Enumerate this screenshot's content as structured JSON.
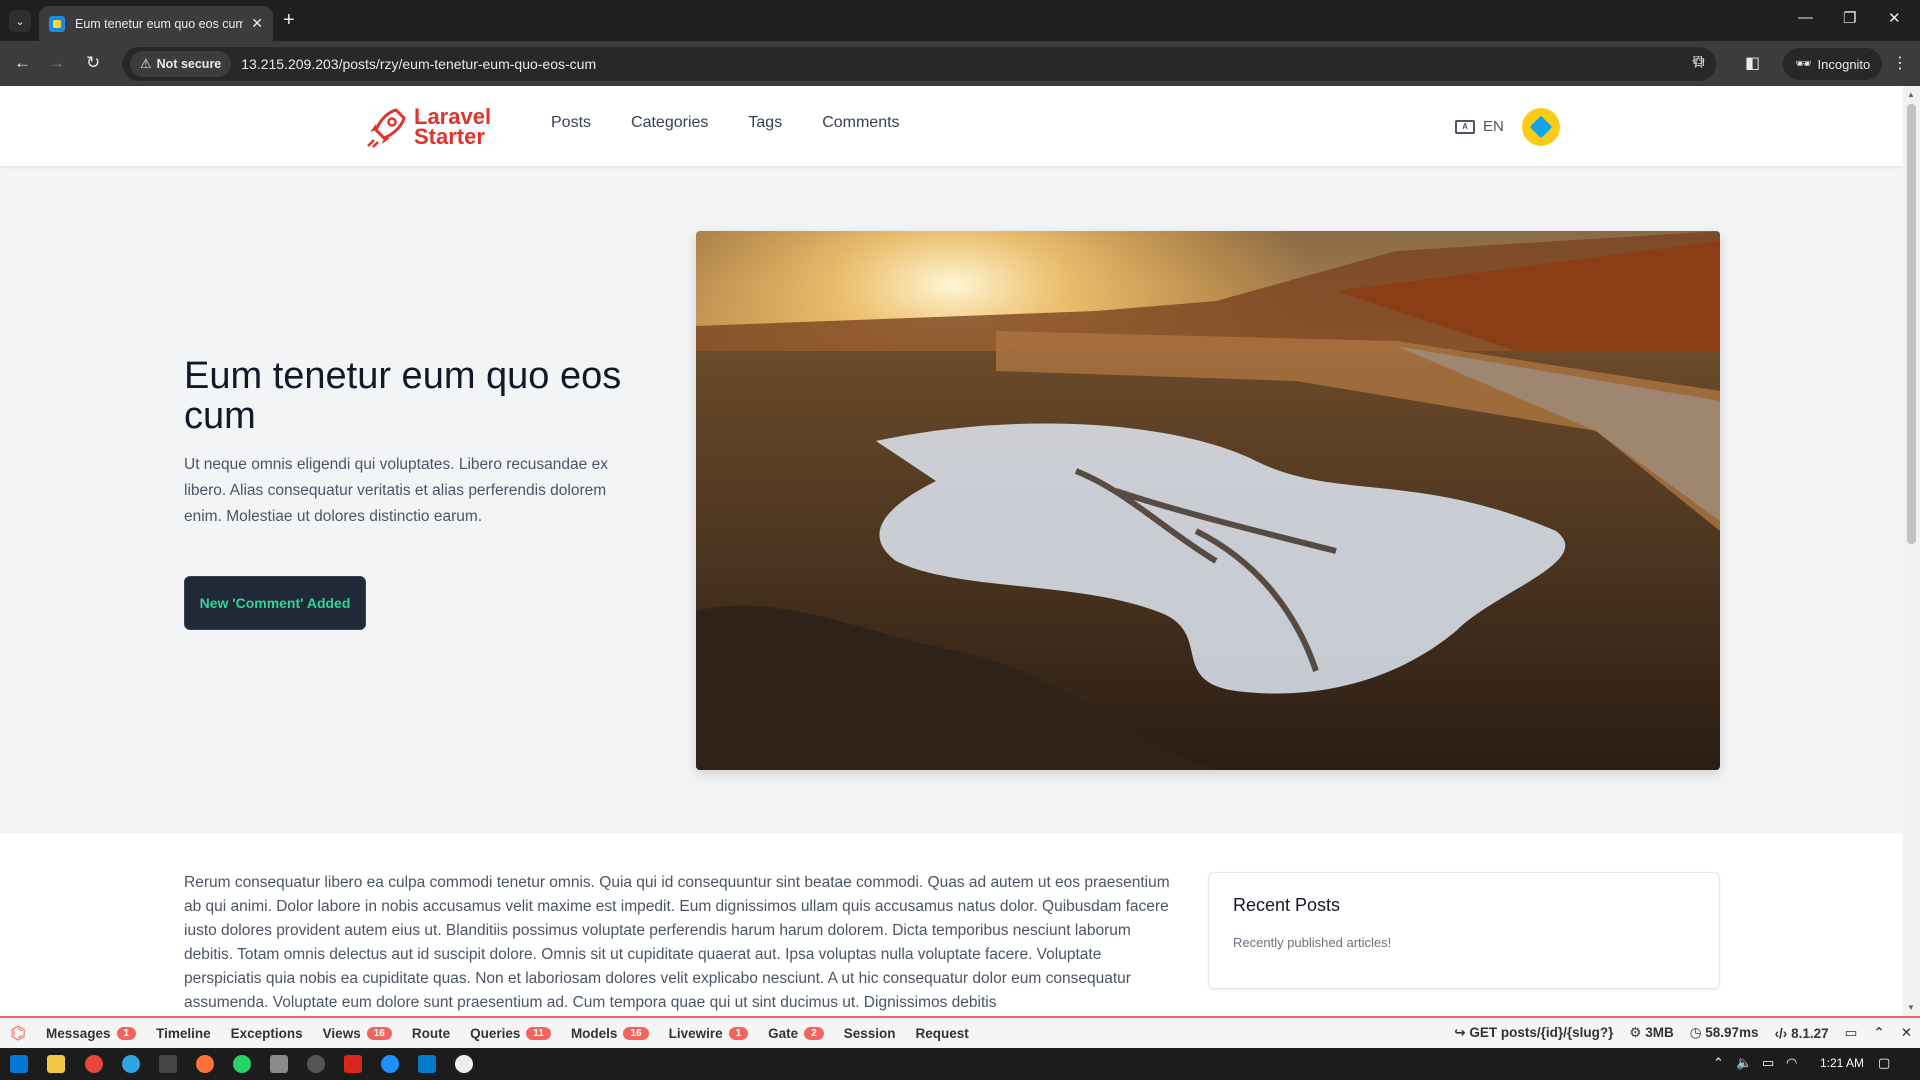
{
  "browser": {
    "tab_title": "Eum tenetur eum quo eos cum",
    "not_secure_label": "Not secure",
    "url": "13.215.209.203/posts/rzy/eum-tenetur-eum-quo-eos-cum",
    "incognito_label": "Incognito"
  },
  "site": {
    "logo_line1": "Laravel",
    "logo_line2": "Starter",
    "nav": [
      "Posts",
      "Categories",
      "Tags",
      "Comments"
    ],
    "lang": "EN"
  },
  "hero": {
    "title": "Eum tenetur eum quo eos cum",
    "excerpt": "Ut neque omnis eligendi qui voluptates. Libero recusandae ex libero. Alias consequatur veritatis et alias perferendis dolorem enim. Molestiae ut dolores distinctio earum.",
    "button_label": "New 'Comment' Added"
  },
  "article": {
    "body": "Rerum consequatur libero ea culpa commodi tenetur omnis. Quia qui id consequuntur sint beatae commodi. Quas ad autem ut eos praesentium ab qui animi. Dolor labore in nobis accusamus velit maxime est impedit. Eum dignissimos ullam quis accusamus natus dolor. Quibusdam facere iusto dolores provident autem eius ut. Blanditiis possimus voluptate perferendis harum harum dolorem. Dicta temporibus nesciunt laborum debitis. Totam omnis delectus aut id suscipit dolore. Omnis sit ut cupiditate quaerat aut. Ipsa voluptas nulla voluptate facere. Voluptate perspiciatis quia nobis ea cupiditate quas. Non et laboriosam dolores velit explicabo nesciunt. A ut hic consequatur dolor eum consequatur assumenda. Voluptate eum dolore sunt praesentium ad. Cum tempora quae qui ut sint ducimus ut. Dignissimos debitis"
  },
  "sidebar": {
    "recent_title": "Recent Posts",
    "recent_subtitle": "Recently published articles!"
  },
  "debugbar": {
    "items": [
      {
        "label": "Messages",
        "badge": "1"
      },
      {
        "label": "Timeline",
        "badge": ""
      },
      {
        "label": "Exceptions",
        "badge": ""
      },
      {
        "label": "Views",
        "badge": "16"
      },
      {
        "label": "Route",
        "badge": ""
      },
      {
        "label": "Queries",
        "badge": "11"
      },
      {
        "label": "Models",
        "badge": "16"
      },
      {
        "label": "Livewire",
        "badge": "1"
      },
      {
        "label": "Gate",
        "badge": "2"
      },
      {
        "label": "Session",
        "badge": ""
      },
      {
        "label": "Request",
        "badge": ""
      }
    ],
    "route": "GET posts/{id}/{slug?}",
    "memory": "3MB",
    "time": "58.97ms",
    "php_version": "8.1.27"
  },
  "taskbar": {
    "time": "1:21 AM"
  },
  "colors": {
    "brand_red": "#e0332d",
    "button_bg": "#1f2937",
    "button_text": "#34d399",
    "debug_accent": "#f4645f"
  }
}
